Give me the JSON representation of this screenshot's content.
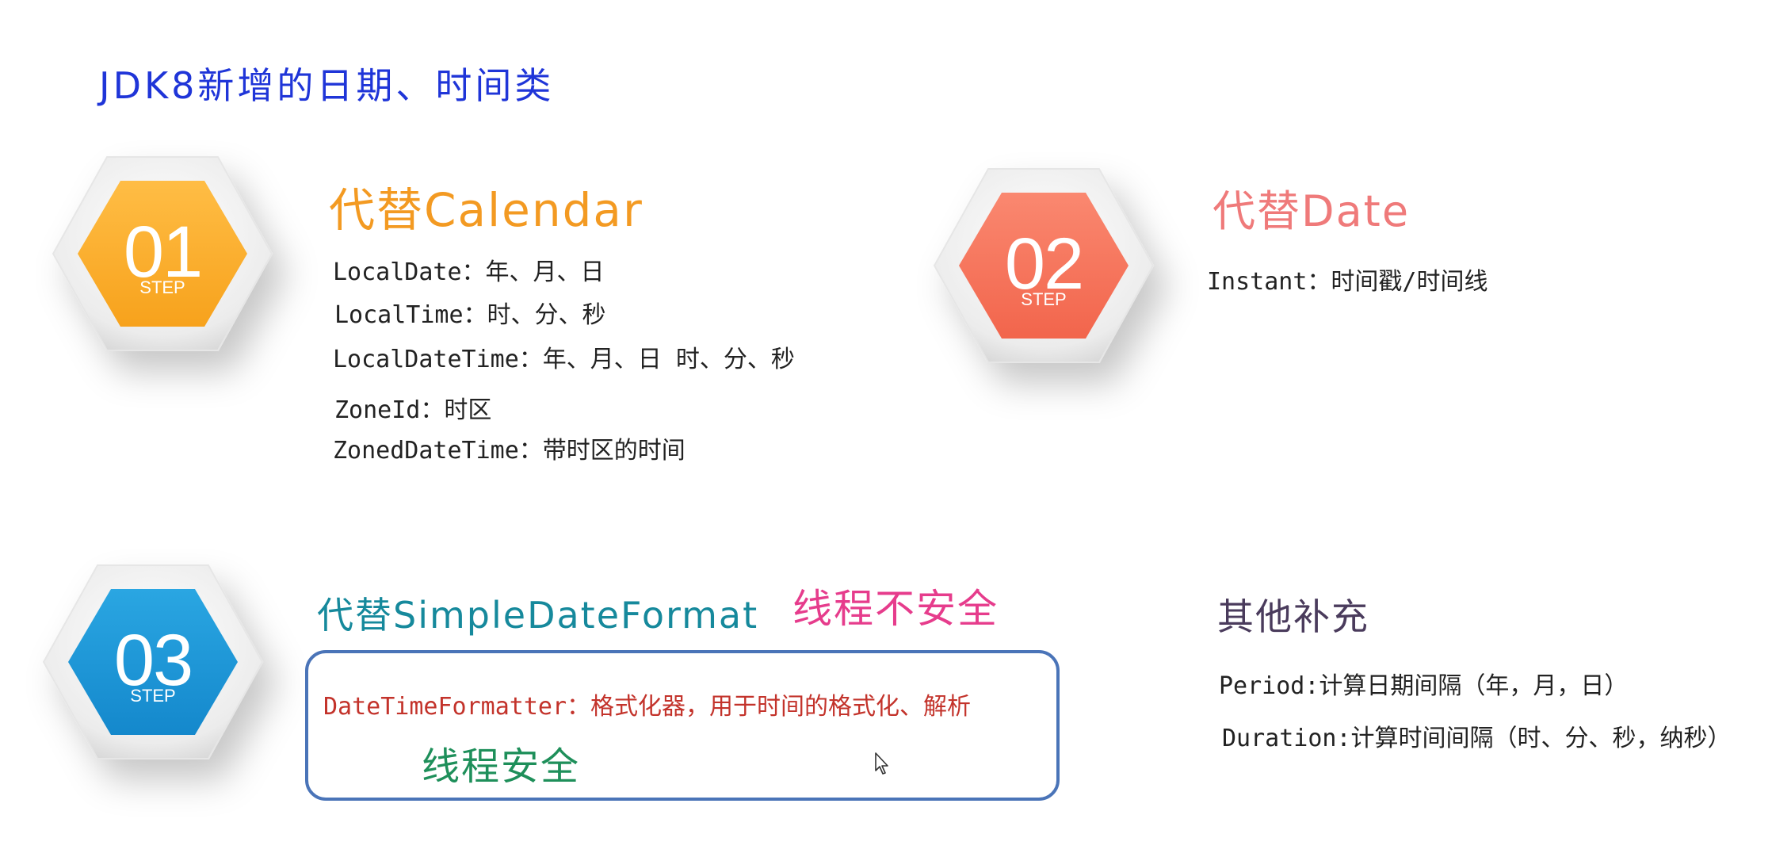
{
  "page": {
    "title": "JDK8新增的日期、时间类"
  },
  "colors": {
    "title": "#1f35d8",
    "step1": "#fbab2c",
    "step2": "#f7735c",
    "step3": "#1f96d6",
    "heading1": "#f39a22",
    "heading2": "#ef7a7a",
    "heading3": "#16899c",
    "warning": "#e63c8c",
    "box_text": "#c3332b",
    "safe_text": "#1e8f5a",
    "heading4": "#4a3b5c",
    "box_border": "#4a74b8"
  },
  "sections": [
    {
      "step_number": "01",
      "step_label": "STEP",
      "heading": "代替Calendar",
      "items": [
        "LocalDate：年、月、日",
        "LocalTime：时、分、秒",
        "LocalDateTime：年、月、日  时、分、秒",
        "ZoneId：时区",
        "ZonedDateTime：带时区的时间"
      ]
    },
    {
      "step_number": "02",
      "step_label": "STEP",
      "heading": "代替Date",
      "items": [
        "Instant：时间戳/时间线"
      ]
    },
    {
      "step_number": "03",
      "step_label": "STEP",
      "heading": "代替SimpleDateFormat",
      "warning": "线程不安全",
      "items": [
        "DateTimeFormatter：格式化器，用于时间的格式化、解析"
      ],
      "note": "线程安全"
    },
    {
      "heading": "其他补充",
      "items": [
        "Period:计算日期间隔（年，月，日）",
        "Duration:计算时间间隔（时、分、秒，纳秒）"
      ]
    }
  ],
  "icons": {
    "cursor": "mouse-pointer-icon"
  }
}
